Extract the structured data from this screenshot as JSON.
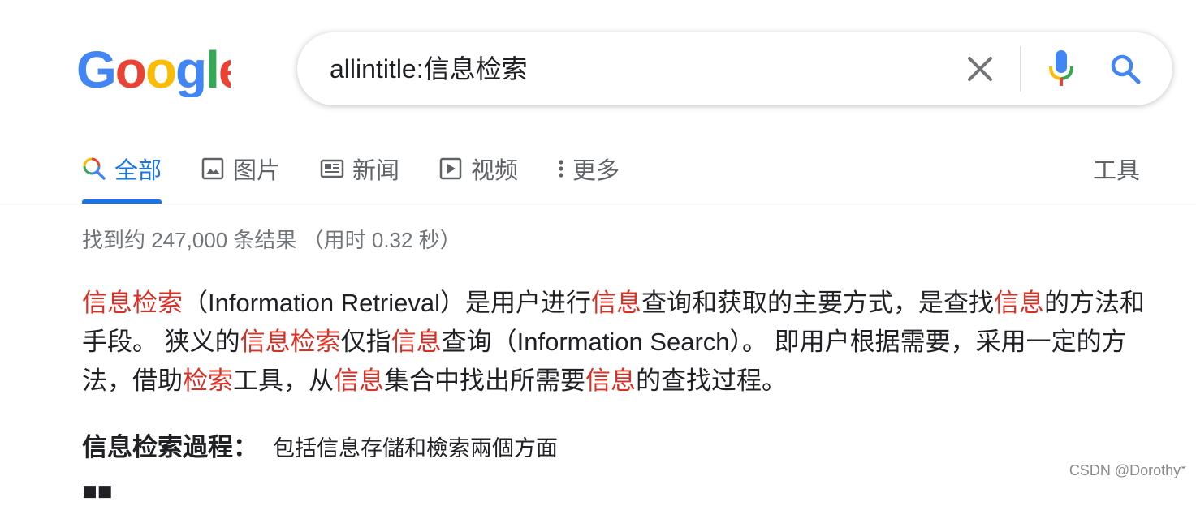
{
  "logo": {
    "text": "Google",
    "colors": [
      "#4285F4",
      "#EA4335",
      "#FBBC05",
      "#4285F4",
      "#34A853",
      "#EA4335"
    ]
  },
  "search": {
    "query": "allintitle:信息检索"
  },
  "tabs": [
    {
      "label": "全部",
      "icon": "search-icon",
      "active": true
    },
    {
      "label": "图片",
      "icon": "image-icon"
    },
    {
      "label": "新闻",
      "icon": "newspaper-icon"
    },
    {
      "label": "视频",
      "icon": "play-icon"
    },
    {
      "label": "更多",
      "icon": "more-vert-icon"
    }
  ],
  "tools_label": "工具",
  "result_stats": "找到约 247,000 条结果  （用时 0.32 秒）",
  "snippet": {
    "segments": [
      {
        "t": "信息检索",
        "h": true
      },
      {
        "t": "（Information Retrieval）是用户进行",
        "h": false
      },
      {
        "t": "信息",
        "h": true
      },
      {
        "t": "查询和获取的主要方式，是查找",
        "h": false
      },
      {
        "t": "信息",
        "h": true
      },
      {
        "t": "的方法和手段。 狭义的",
        "h": false
      },
      {
        "t": "信息检索",
        "h": true
      },
      {
        "t": "仅指",
        "h": false
      },
      {
        "t": "信息",
        "h": true
      },
      {
        "t": "查询（Information Search）。 即用户根据需要，采用一定的方法，借助",
        "h": false
      },
      {
        "t": "检索",
        "h": true
      },
      {
        "t": "工具，从",
        "h": false
      },
      {
        "t": "信息",
        "h": true
      },
      {
        "t": "集合中找出所需要",
        "h": false
      },
      {
        "t": "信息",
        "h": true
      },
      {
        "t": "的查找过程。",
        "h": false
      }
    ]
  },
  "facts": [
    {
      "key": "信息检索過程：",
      "value": "包括信息存儲和檢索兩個方面"
    }
  ],
  "watermark": "CSDN @Dorothy𝄻",
  "colors": {
    "accent": "#1a73e8",
    "highlight": "#d93025",
    "muted": "#70757a"
  }
}
